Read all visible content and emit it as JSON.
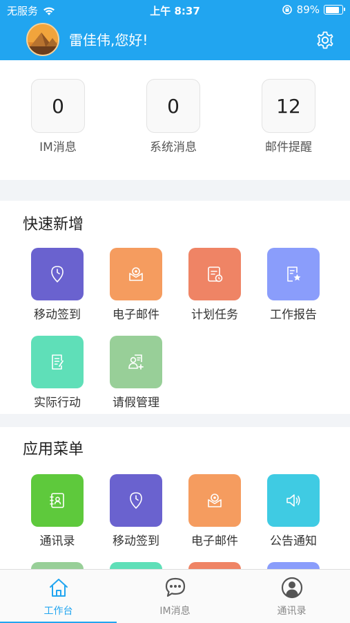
{
  "status_bar": {
    "carrier": "无服务",
    "time": "上午 8:37",
    "battery": "89%",
    "battery_level": 0.89
  },
  "header": {
    "greeting": "雷佳伟,您好!"
  },
  "stats": [
    {
      "value": "0",
      "label": "IM消息"
    },
    {
      "value": "0",
      "label": "系统消息"
    },
    {
      "value": "12",
      "label": "邮件提醒"
    }
  ],
  "quick_add": {
    "title": "快速新增",
    "items": [
      {
        "label": "移动签到",
        "icon": "clock-pin-icon",
        "color": "#6a62cf"
      },
      {
        "label": "电子邮件",
        "icon": "mail-icon",
        "color": "#f59c5f"
      },
      {
        "label": "计划任务",
        "icon": "task-plan-icon",
        "color": "#ef8465"
      },
      {
        "label": "工作报告",
        "icon": "report-star-icon",
        "color": "#8a9dfb"
      },
      {
        "label": "实际行动",
        "icon": "edit-doc-icon",
        "color": "#5fdfb8"
      },
      {
        "label": "请假管理",
        "icon": "leave-user-icon",
        "color": "#98cf98"
      }
    ]
  },
  "app_menu": {
    "title": "应用菜单",
    "items": [
      {
        "label": "通讯录",
        "icon": "contacts-icon",
        "color": "#5ec93c"
      },
      {
        "label": "移动签到",
        "icon": "clock-pin-icon",
        "color": "#6a62cf"
      },
      {
        "label": "电子邮件",
        "icon": "mail-icon",
        "color": "#f59c5f"
      },
      {
        "label": "公告通知",
        "icon": "speaker-icon",
        "color": "#3fcbe3"
      }
    ],
    "partial_row_colors": [
      "#98cf98",
      "#5fdfb8",
      "#ef8465",
      "#8a9dfb"
    ]
  },
  "tabbar": {
    "tabs": [
      {
        "label": "工作台",
        "icon": "home-icon",
        "active": true
      },
      {
        "label": "IM消息",
        "icon": "chat-icon",
        "active": false
      },
      {
        "label": "通讯录",
        "icon": "person-icon",
        "active": false
      }
    ]
  },
  "colors": {
    "brand": "#21a5f0"
  }
}
